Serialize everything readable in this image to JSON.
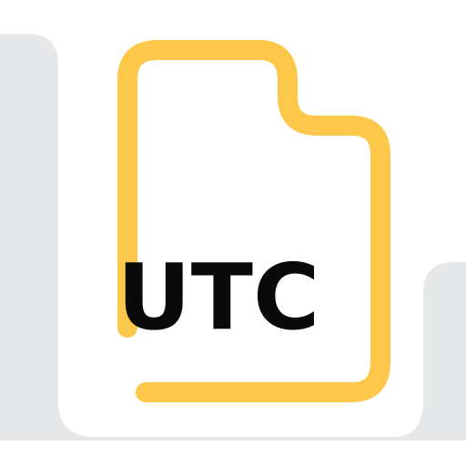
{
  "icon": {
    "name": "utc-file-icon",
    "label": "UTC",
    "colors": {
      "background_shape": "#e6e7e8",
      "card": "#ffffff",
      "outline": "#fdc849",
      "text": "#0a0a0a"
    }
  }
}
